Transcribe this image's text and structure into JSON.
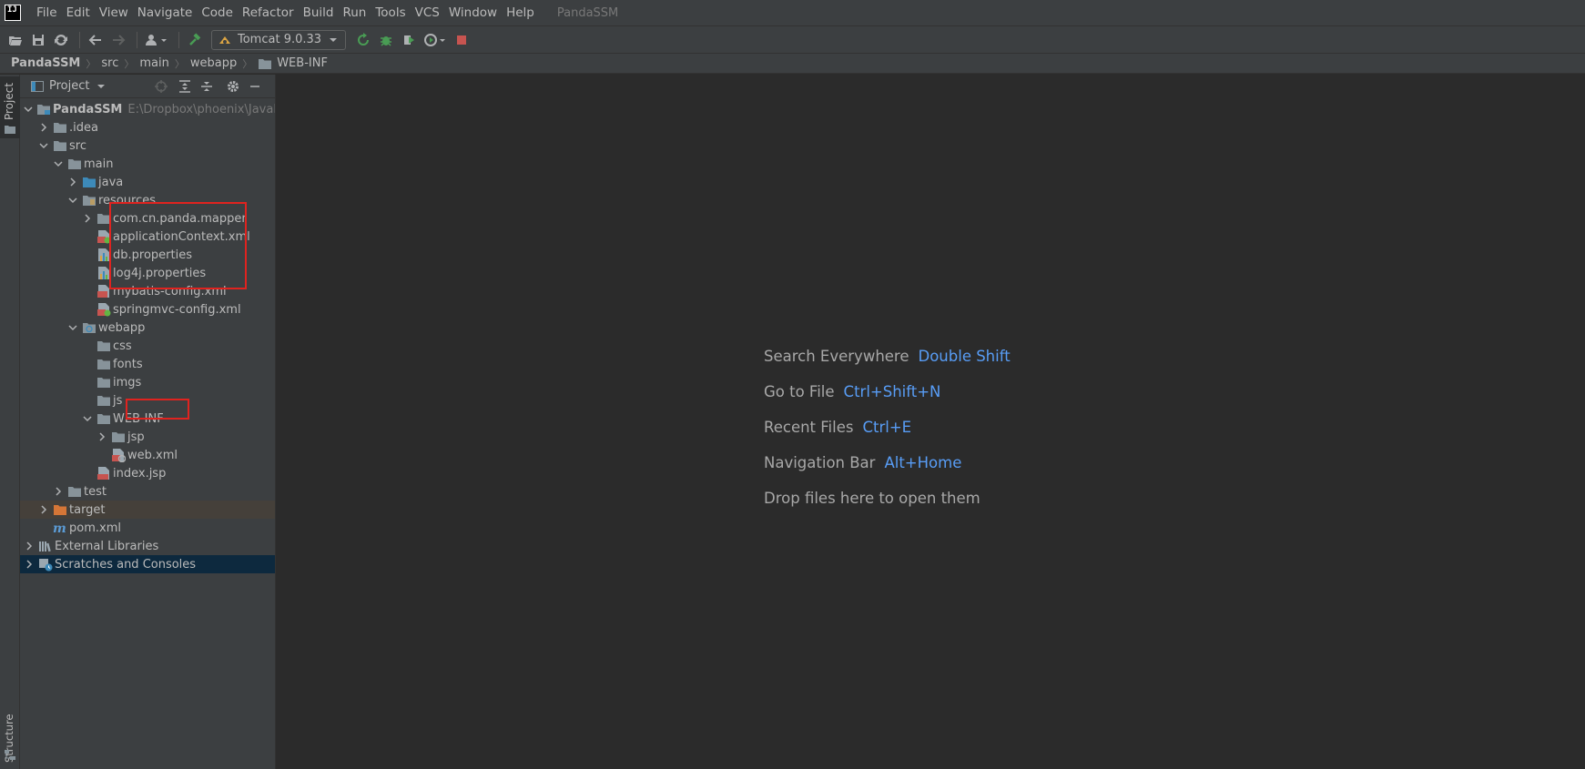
{
  "menubar": {
    "logo": "IJ",
    "items": [
      "File",
      "Edit",
      "View",
      "Navigate",
      "Code",
      "Refactor",
      "Build",
      "Run",
      "Tools",
      "VCS",
      "Window",
      "Help"
    ],
    "window_title": "PandaSSM"
  },
  "toolbar": {
    "run_config": "Tomcat 9.0.33",
    "icons": [
      "open-icon",
      "save-icon",
      "sync-icon",
      "back-icon",
      "forward-icon",
      "user-icon",
      "build-hammer-icon",
      "rerun-icon",
      "debug-icon",
      "coverage-icon",
      "profile-icon",
      "stop-icon"
    ]
  },
  "navbar": {
    "crumbs": [
      "PandaSSM",
      "src",
      "main",
      "webapp",
      "WEB-INF"
    ]
  },
  "stripe": {
    "project_label": "Project",
    "structure_label": "Structure"
  },
  "panel": {
    "title": "Project"
  },
  "tree": [
    {
      "label": "PandaSSM",
      "hint": "E:\\Dropbox\\phoenix\\JavaPro",
      "depth": 0,
      "expanded": true,
      "icon": "module-folder-icon",
      "bold": true
    },
    {
      "label": ".idea",
      "depth": 1,
      "expanded": false,
      "icon": "folder-icon"
    },
    {
      "label": "src",
      "depth": 1,
      "expanded": true,
      "icon": "folder-icon"
    },
    {
      "label": "main",
      "depth": 2,
      "expanded": true,
      "icon": "folder-icon"
    },
    {
      "label": "java",
      "depth": 3,
      "expanded": false,
      "icon": "source-folder-icon"
    },
    {
      "label": "resources",
      "depth": 3,
      "expanded": true,
      "icon": "resources-folder-icon"
    },
    {
      "label": "com.cn.panda.mapper",
      "depth": 4,
      "expanded": false,
      "icon": "folder-icon"
    },
    {
      "label": "applicationContext.xml",
      "depth": 4,
      "icon": "spring-xml-icon"
    },
    {
      "label": "db.properties",
      "depth": 4,
      "icon": "properties-icon"
    },
    {
      "label": "log4j.properties",
      "depth": 4,
      "icon": "properties-icon"
    },
    {
      "label": "mybatis-config.xml",
      "depth": 4,
      "icon": "xml-file-icon"
    },
    {
      "label": "springmvc-config.xml",
      "depth": 4,
      "icon": "spring-xml-icon"
    },
    {
      "label": "webapp",
      "depth": 3,
      "expanded": true,
      "icon": "web-folder-icon"
    },
    {
      "label": "css",
      "depth": 4,
      "icon": "folder-icon"
    },
    {
      "label": "fonts",
      "depth": 4,
      "icon": "folder-icon"
    },
    {
      "label": "imgs",
      "depth": 4,
      "icon": "folder-icon"
    },
    {
      "label": "js",
      "depth": 4,
      "icon": "folder-icon"
    },
    {
      "label": "WEB-INF",
      "depth": 4,
      "expanded": true,
      "icon": "folder-icon"
    },
    {
      "label": "jsp",
      "depth": 5,
      "expanded": false,
      "icon": "folder-icon"
    },
    {
      "label": "web.xml",
      "depth": 5,
      "icon": "web-xml-icon"
    },
    {
      "label": "index.jsp",
      "depth": 4,
      "icon": "jsp-file-icon"
    },
    {
      "label": "test",
      "depth": 2,
      "expanded": false,
      "icon": "folder-icon"
    },
    {
      "label": "target",
      "depth": 1,
      "expanded": false,
      "icon": "excluded-folder-icon",
      "state": "excluded"
    },
    {
      "label": "pom.xml",
      "depth": 1,
      "icon": "maven-icon"
    },
    {
      "label": "External Libraries",
      "depth": 0,
      "expanded": false,
      "icon": "libraries-icon"
    },
    {
      "label": "Scratches and Consoles",
      "depth": 0,
      "expanded": false,
      "icon": "scratches-icon",
      "state": "selected"
    }
  ],
  "editor": {
    "hints": [
      {
        "text": "Search Everywhere",
        "key": "Double Shift"
      },
      {
        "text": "Go to File",
        "key": "Ctrl+Shift+N"
      },
      {
        "text": "Recent Files",
        "key": "Ctrl+E"
      },
      {
        "text": "Navigation Bar",
        "key": "Alt+Home"
      },
      {
        "text": "Drop files here to open them",
        "key": ""
      }
    ]
  },
  "colors": {
    "accent_key": "#589df6",
    "annotation_red": "#e0231f",
    "folder": "#87939a",
    "source_folder": "#3d8ab9",
    "excluded_folder": "#d57637"
  }
}
